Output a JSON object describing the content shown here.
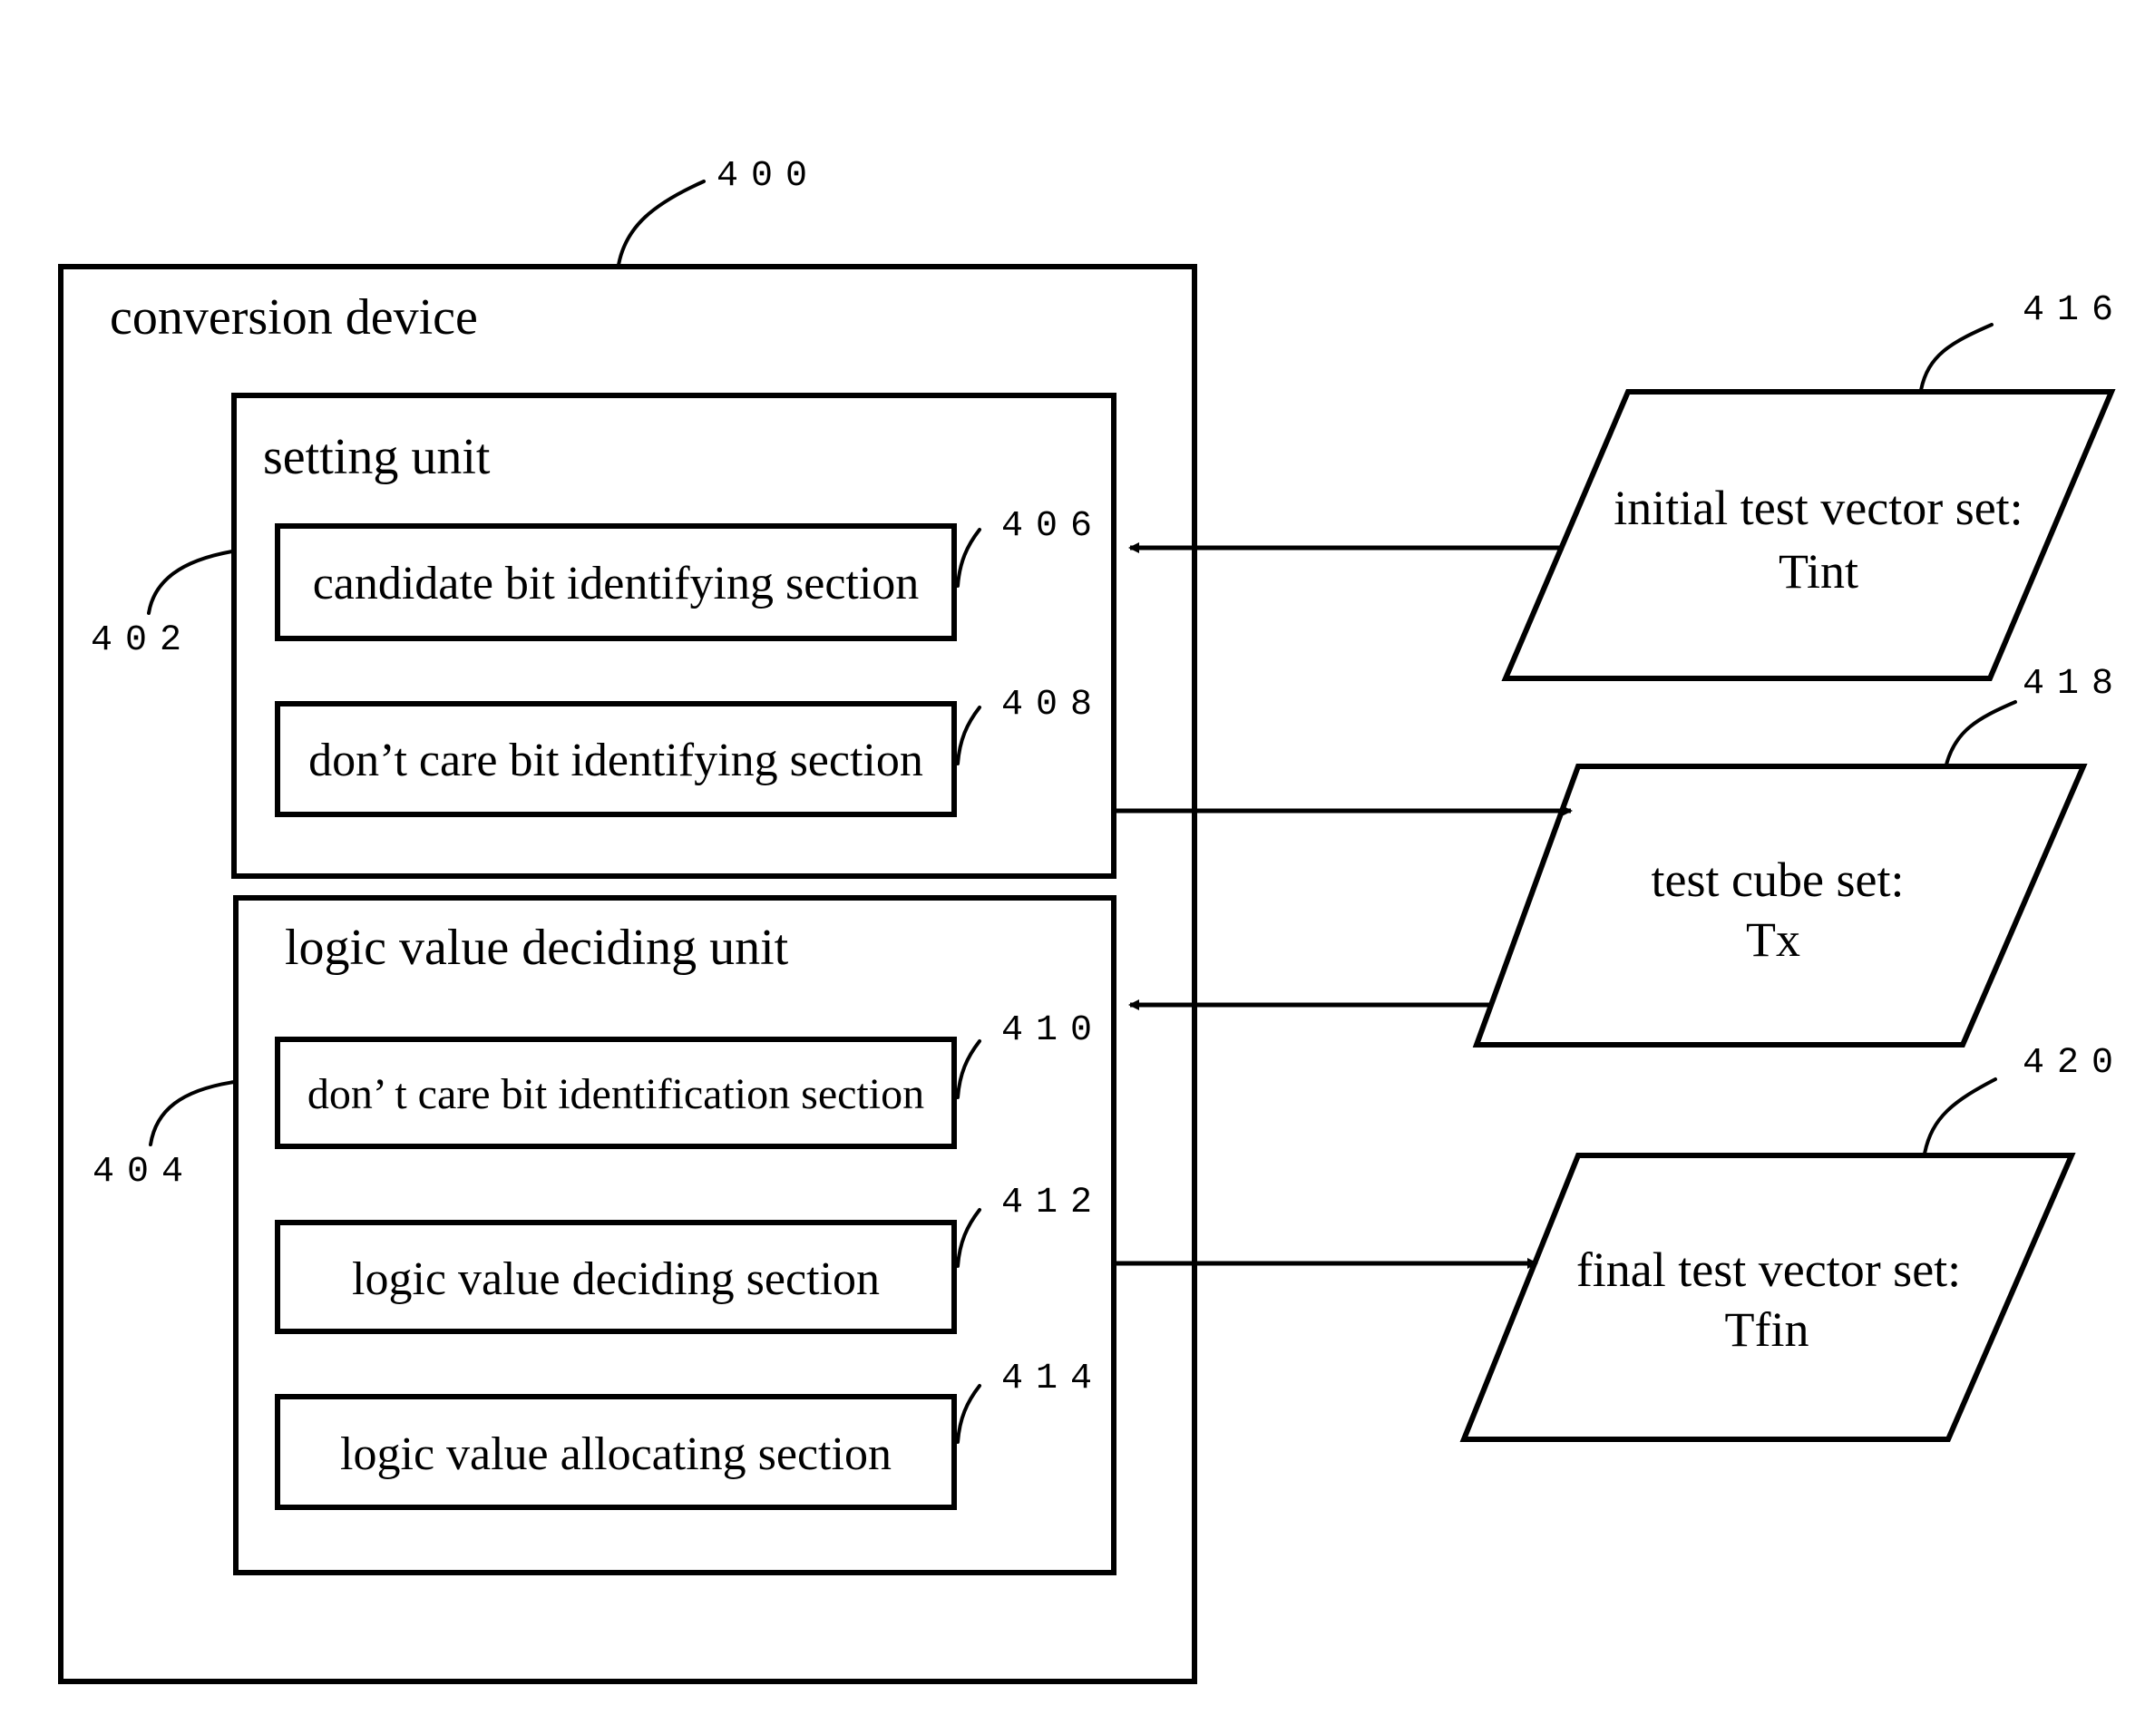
{
  "diagram": {
    "conversion_device": {
      "ref": "400",
      "label": "conversion device",
      "setting_unit": {
        "ref": "402",
        "label": "setting unit",
        "sections": [
          {
            "ref": "406",
            "label": "candidate bit identifying section"
          },
          {
            "ref": "408",
            "label": "don’t care bit identifying section"
          }
        ]
      },
      "logic_value_deciding_unit": {
        "ref": "404",
        "label": "logic value deciding unit",
        "sections": [
          {
            "ref": "410",
            "label": "don’ t care bit identification section"
          },
          {
            "ref": "412",
            "label": "logic value deciding section"
          },
          {
            "ref": "414",
            "label": "logic value allocating section"
          }
        ]
      }
    },
    "data_sets": [
      {
        "ref": "416",
        "line1": "initial test vector set:",
        "line2": "Tint"
      },
      {
        "ref": "418",
        "line1": "test cube set:",
        "line2": "Tx"
      },
      {
        "ref": "420",
        "line1": "final test vector set:",
        "line2": "Tfin"
      }
    ],
    "flows": [
      {
        "from": "initial test vector set",
        "to": "setting unit"
      },
      {
        "from": "setting unit",
        "to": "test cube set"
      },
      {
        "from": "test cube set",
        "to": "logic value deciding unit"
      },
      {
        "from": "logic value deciding unit",
        "to": "final test vector set"
      }
    ]
  }
}
